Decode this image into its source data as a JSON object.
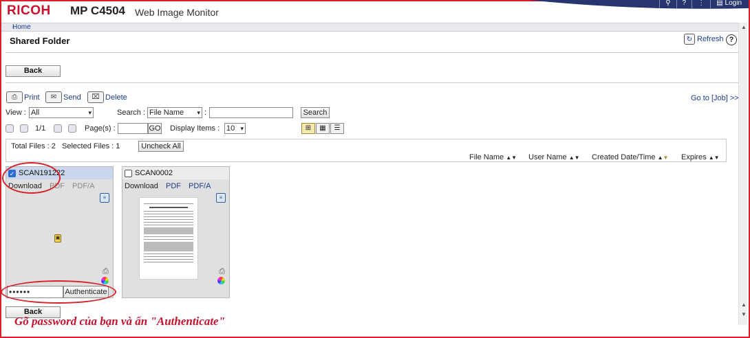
{
  "header": {
    "brand": "RICOH",
    "model": "MP C4504",
    "product": "Web Image Monitor",
    "top_icons": [
      "search-icon",
      "help-icon",
      "menu-icon",
      "login-icon"
    ],
    "login_label": "Login",
    "search_glyph": "⚲",
    "help_glyph": "?",
    "menu_glyph": "⋮",
    "login_glyph": "▤"
  },
  "breadcrumb": {
    "arrow": "‹",
    "home_label": "Home"
  },
  "page": {
    "title": "Shared Folder",
    "refresh_label": "Refresh",
    "refresh_glyph": "↻",
    "help_glyph": "?"
  },
  "buttons": {
    "back_top": "Back",
    "back_bottom": "Back",
    "search": "Search",
    "go": "GO",
    "uncheck_all": "Uncheck All",
    "authenticate": "Authenticate"
  },
  "toolbar": {
    "print_label": "Print",
    "send_label": "Send",
    "delete_label": "Delete",
    "print_glyph": "⎙",
    "send_glyph": "✉",
    "delete_glyph": "⌧",
    "goto_label": "Go to [Job] >>"
  },
  "filters": {
    "view_label": "View :",
    "view_value": "All",
    "search_label": "Search :",
    "search_field_value": "File Name",
    "search_query": "",
    "page_counter": "1/1",
    "pages_label": "Page(s) :",
    "page_input": "",
    "display_items_label": "Display Items :",
    "display_items_value": "10",
    "select_arrow": "▾",
    "view_mode_glyphs": [
      "⊞",
      "▦",
      "☰"
    ]
  },
  "summary": {
    "total_files_label": "Total Files :",
    "total_files": "2",
    "selected_files_label": "Selected Files :",
    "selected_files": "1"
  },
  "sort_columns": [
    {
      "label": "File Name"
    },
    {
      "label": "User Name"
    },
    {
      "label": "Created Date/Time"
    },
    {
      "label": "Expires"
    }
  ],
  "sort_glyphs": {
    "asc": "▲",
    "desc": "▼"
  },
  "files": [
    {
      "name": "SCAN191222",
      "checked": true,
      "links": [
        "Download",
        "PDF",
        "PDF/A"
      ],
      "locked": true,
      "password_mask": "••••••"
    },
    {
      "name": "SCAN0002",
      "checked": false,
      "links": [
        "Download",
        "PDF",
        "PDF/A"
      ],
      "locked": false
    }
  ],
  "glyphs": {
    "check": "✓",
    "detail": "≡",
    "lock": "▣",
    "printer": "⎙"
  },
  "caption": "Gõ password của bạn và ấn \"Authenticate\"",
  "colors": {
    "accent": "#c8102e",
    "annotation": "#d8202a",
    "link": "#1a3c8a",
    "selected_header": "#c9d6ec"
  }
}
